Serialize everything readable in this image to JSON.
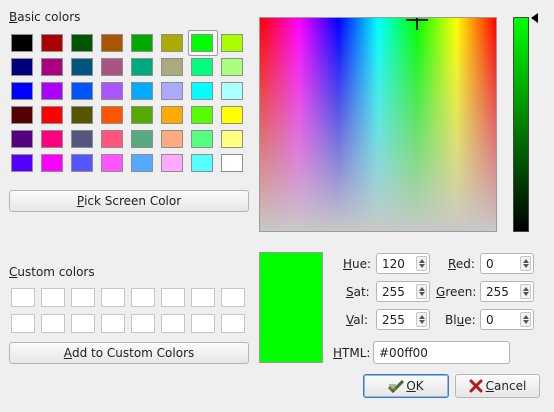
{
  "basic_colors": {
    "label_u": "B",
    "label_rest": "asic colors",
    "rows": [
      [
        "#000000",
        "#aa0000",
        "#005500",
        "#aa5500",
        "#00aa00",
        "#aaaa00",
        "#00ff00",
        "#aaff00"
      ],
      [
        "#00007f",
        "#aa007f",
        "#00557f",
        "#aa557f",
        "#00aa7f",
        "#aaaa7f",
        "#00ff7f",
        "#aaff7f"
      ],
      [
        "#0000ff",
        "#aa00ff",
        "#0055ff",
        "#aa55ff",
        "#00aaff",
        "#aaaaff",
        "#00ffff",
        "#aaffff"
      ],
      [
        "#550000",
        "#ff0000",
        "#555500",
        "#ff5500",
        "#55aa00",
        "#ffaa00",
        "#55ff00",
        "#ffff00"
      ],
      [
        "#55007f",
        "#ff007f",
        "#55557f",
        "#ff557f",
        "#55aa7f",
        "#ffaa7f",
        "#55ff7f",
        "#ffff7f"
      ],
      [
        "#5500ff",
        "#ff00ff",
        "#5555ff",
        "#ff55ff",
        "#55aaff",
        "#ffaaff",
        "#55ffff",
        "#ffffff"
      ]
    ],
    "selected_swatch": "#00ff00"
  },
  "pick_screen_color": {
    "u": "P",
    "rest": "ick Screen Color"
  },
  "custom_colors": {
    "label_u": "C",
    "label_rest": "ustom colors",
    "slots": 16,
    "slot_color": "#ffffff"
  },
  "add_to_custom": {
    "u": "A",
    "rest": "dd to Custom Colors"
  },
  "current_color": "#00ff00",
  "hsv": {
    "hue": {
      "u": "H",
      "pre": "",
      "label": "ue:",
      "value": "120"
    },
    "sat": {
      "u": "S",
      "pre": "",
      "label": "at:",
      "value": "255"
    },
    "val": {
      "u": "V",
      "pre": "",
      "label": "al:",
      "value": "255"
    }
  },
  "rgb": {
    "red": {
      "u": "R",
      "pre": "",
      "label": "ed:",
      "value": "0"
    },
    "green": {
      "u": "G",
      "pre": "",
      "label": "reen:",
      "value": "255"
    },
    "blue": {
      "u": "u",
      "pre": "Bl",
      "label": "e:",
      "value": "0"
    }
  },
  "html": {
    "u": "H",
    "label": "TML:",
    "value": "#00ff00"
  },
  "ok_button": {
    "u": "O",
    "rest": "K"
  },
  "cancel_button": {
    "u": "C",
    "rest": "ancel"
  },
  "luminance_arrow": "◀"
}
